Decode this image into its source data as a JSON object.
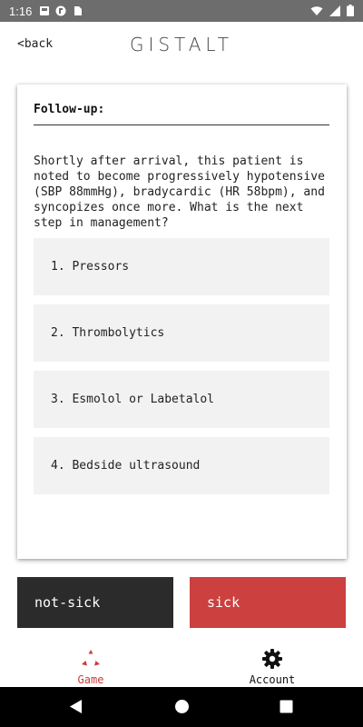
{
  "status_bar": {
    "time": "1:16"
  },
  "header": {
    "back_label": "<back",
    "logo": "GISTALT"
  },
  "card": {
    "title": "Follow-up:",
    "question": "Shortly after arrival, this patient is noted to become progressively hypotensive (SBP 88mmHg), bradycardic (HR 58bpm), and syncopizes once more. What is the next step in management?",
    "answers": [
      {
        "label": "1. Pressors"
      },
      {
        "label": "2. Thrombolytics"
      },
      {
        "label": "3. Esmolol or Labetalol"
      },
      {
        "label": "4. Bedside ultrasound"
      }
    ]
  },
  "actions": {
    "not_sick_label": "not-sick",
    "sick_label": "sick"
  },
  "bottom_nav": {
    "game_label": "Game",
    "account_label": "Account"
  },
  "colors": {
    "accent": "#cc4040",
    "dark_button": "#2b2b2b",
    "answer_bg": "#f2f2f2"
  },
  "icons": [
    "wifi-icon",
    "signal-icon",
    "battery-icon",
    "game-icon",
    "gear-icon",
    "back-triangle-icon",
    "home-circle-icon",
    "recents-square-icon"
  ]
}
